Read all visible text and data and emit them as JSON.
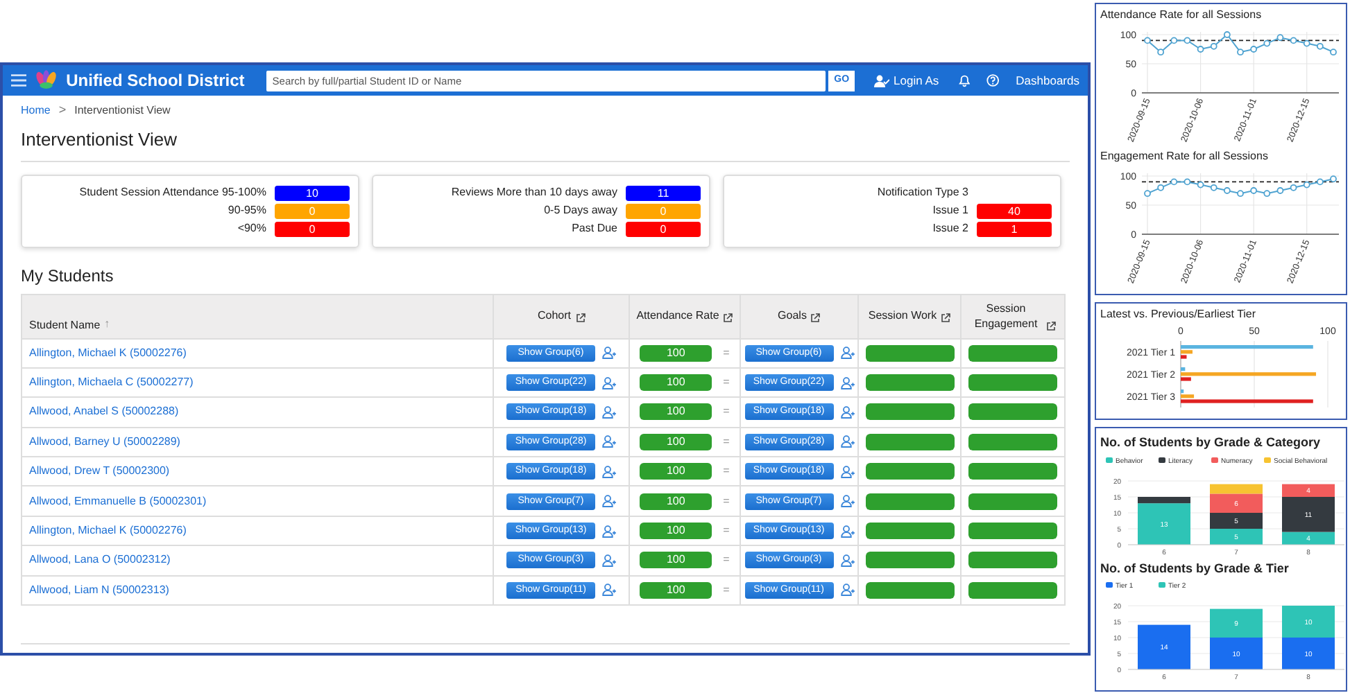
{
  "header": {
    "app_name": "Unified School District",
    "search": {
      "placeholder": "Search by full/partial Student ID or Name"
    },
    "go": "GO",
    "login_as": "Login As",
    "dashboards": "Dashboards"
  },
  "breadcrumb": {
    "separator": ">",
    "items": [
      {
        "label": "Home"
      },
      {
        "label": "Interventionist View"
      }
    ]
  },
  "title": "Interventionist View",
  "summary_cards": [
    {
      "items": [
        {
          "label": "Student Session Attendance 95-100%",
          "value": "10",
          "color": "#0000ff"
        },
        {
          "label": "90-95%",
          "value": "0",
          "color": "#ffa500"
        },
        {
          "label": "<90%",
          "value": "0",
          "color": "#ff0000"
        }
      ]
    },
    {
      "items": [
        {
          "label": "Reviews More than 10 days away",
          "value": "11",
          "color": "#0000ff"
        },
        {
          "label": "0-5 Days away",
          "value": "0",
          "color": "#ffa500"
        },
        {
          "label": "Past Due",
          "value": "0",
          "color": "#ff0000"
        }
      ]
    },
    {
      "items": [
        {
          "label": "Notification Type 3"
        },
        {
          "label": "Issue 1",
          "value": "40",
          "color": "#ff0000"
        },
        {
          "label": "Issue 2",
          "value": "1",
          "color": "#ff0000"
        }
      ]
    }
  ],
  "section_title": "My Students",
  "table": {
    "columns": [
      {
        "label": "Student Name",
        "sort_indicator": "↑",
        "link_icon": false
      },
      {
        "label": "Cohort",
        "link_icon": true
      },
      {
        "label": "Attendance Rate",
        "link_icon": true
      },
      {
        "label": "Goals",
        "link_icon": true
      },
      {
        "label": "Session Work",
        "link_icon": true
      },
      {
        "label": "Session Engagement",
        "link_icon": true
      }
    ],
    "rows": [
      {
        "student": "Allington, Michael K (50002276)",
        "cohort": "Show Group(6)",
        "attendance": "100",
        "trend": "=",
        "goals": "Show Group(6)",
        "session_work": {
          "level": 1
        },
        "session_engagement": {
          "level": 1
        }
      },
      {
        "student": "Allington, Michaela C (50002277)",
        "cohort": "Show Group(22)",
        "attendance": "100",
        "trend": "=",
        "goals": "Show Group(22)",
        "session_work": {
          "level": 1
        },
        "session_engagement": {
          "level": 1
        }
      },
      {
        "student": "Allwood, Anabel S (50002288)",
        "cohort": "Show Group(18)",
        "attendance": "100",
        "trend": "=",
        "goals": "Show Group(18)",
        "session_work": {
          "level": 1
        },
        "session_engagement": {
          "level": 1
        }
      },
      {
        "student": "Allwood, Barney U (50002289)",
        "cohort": "Show Group(28)",
        "attendance": "100",
        "trend": "=",
        "goals": "Show Group(28)",
        "session_work": {
          "level": 1
        },
        "session_engagement": {
          "level": 1
        }
      },
      {
        "student": "Allwood, Drew T (50002300)",
        "cohort": "Show Group(18)",
        "attendance": "100",
        "trend": "=",
        "goals": "Show Group(18)",
        "session_work": {
          "level": 1
        },
        "session_engagement": {
          "level": 1
        }
      },
      {
        "student": "Allwood, Emmanuelle B (50002301)",
        "cohort": "Show Group(7)",
        "attendance": "100",
        "trend": "=",
        "goals": "Show Group(7)",
        "session_work": {
          "level": 1
        },
        "session_engagement": {
          "level": 1
        }
      },
      {
        "student": "Allington, Michael K (50002276)",
        "cohort": "Show Group(13)",
        "attendance": "100",
        "trend": "=",
        "goals": "Show Group(13)",
        "session_work": {
          "level": 1
        },
        "session_engagement": {
          "level": 1
        }
      },
      {
        "student": "Allwood, Lana O (50002312)",
        "cohort": "Show Group(3)",
        "attendance": "100",
        "trend": "=",
        "goals": "Show Group(3)",
        "session_work": {
          "level": 1
        },
        "session_engagement": {
          "level": 1
        }
      },
      {
        "student": "Allwood, Liam N (50002313)",
        "cohort": "Show Group(11)",
        "attendance": "100",
        "trend": "=",
        "goals": "Show Group(11)",
        "session_work": {
          "level": 1
        },
        "session_engagement": {
          "level": 1
        }
      }
    ]
  },
  "side_panels": [
    {
      "charts": [
        {
          "chart_data": {
            "type": "line",
            "title": "Attendance Rate for all Sessions",
            "categories": [
              "2020-09-15",
              null,
              null,
              null,
              "2020-10-06",
              null,
              null,
              null,
              "2020-11-01",
              null,
              null,
              null,
              "2020-12-15",
              null,
              null
            ],
            "series": [
              {
                "color": "#4fa3d1",
                "marker": "circle",
                "values": [
                  90,
                  70,
                  90,
                  90,
                  75,
                  80,
                  100,
                  70,
                  75,
                  85,
                  95,
                  90,
                  85,
                  80,
                  70
                ]
              }
            ],
            "ylim": [
              0,
              100
            ],
            "yticks": [
              0,
              50,
              100
            ],
            "grid": true,
            "ref_lines": [
              {
                "axis": "y",
                "value": 90
              }
            ]
          }
        },
        {
          "chart_data": {
            "type": "line",
            "title": "Engagement Rate for all Sessions",
            "categories": [
              "2020-09-15",
              null,
              null,
              null,
              "2020-10-06",
              null,
              null,
              null,
              "2020-11-01",
              null,
              null,
              null,
              "2020-12-15",
              null,
              null
            ],
            "series": [
              {
                "color": "#4fa3d1",
                "marker": "circle",
                "values": [
                  70,
                  80,
                  90,
                  90,
                  85,
                  80,
                  75,
                  70,
                  75,
                  70,
                  75,
                  80,
                  85,
                  90,
                  95
                ]
              }
            ],
            "ylim": [
              0,
              100
            ],
            "yticks": [
              0,
              50,
              100
            ],
            "grid": true,
            "ref_lines": [
              {
                "axis": "y",
                "value": 90
              }
            ]
          }
        }
      ]
    },
    {
      "charts": [
        {
          "chart_data": {
            "type": "bar",
            "orientation": "horizontal",
            "title": "Latest vs. Previous/Earliest Tier",
            "categories": [
              "2021 Tier 1",
              "2021 Tier 2",
              "2021 Tier 3"
            ],
            "series": [
              {
                "color": "#5ab4e0",
                "values": [
                  90,
                  3,
                  2
                ]
              },
              {
                "color": "#f5a623",
                "values": [
                  8,
                  92,
                  9
                ]
              },
              {
                "color": "#e02020",
                "values": [
                  4,
                  7,
                  90
                ]
              }
            ],
            "xlim": [
              0,
              100
            ],
            "xticks": [
              0,
              50,
              100
            ]
          }
        }
      ]
    },
    {
      "charts": [
        {
          "chart_data": {
            "type": "bar",
            "stacked": true,
            "title": "No. of Students by Grade & Category",
            "categories": [
              "6",
              "7",
              "8"
            ],
            "series": [
              {
                "name": "Behavior",
                "color": "#2ec4b6",
                "values": [
                  13,
                  5,
                  4
                ]
              },
              {
                "name": "Literacy",
                "color": "#343a40",
                "values": [
                  2,
                  5,
                  11
                ]
              },
              {
                "name": "Numeracy",
                "color": "#f25c5c",
                "values": [
                  null,
                  6,
                  4
                ]
              },
              {
                "name": "Social Behavioral",
                "color": "#f7c331",
                "values": [
                  null,
                  3,
                  null
                ]
              }
            ],
            "ylim": [
              0,
              20
            ],
            "yticks": [
              0,
              5,
              10,
              15,
              20
            ],
            "grid": true,
            "legend": true,
            "value_labels": [
              [
                "13",
                "5",
                "4"
              ],
              [
                null,
                "5",
                "11"
              ],
              [
                null,
                "6",
                "4"
              ],
              [
                null,
                null,
                null
              ]
            ]
          }
        },
        {
          "chart_data": {
            "type": "bar",
            "stacked": true,
            "title": "No. of Students by Grade & Tier",
            "categories": [
              "6",
              "7",
              "8"
            ],
            "series": [
              {
                "name": "Tier 1",
                "color": "#1a6ef0",
                "values": [
                  14,
                  10,
                  10
                ]
              },
              {
                "name": "Tier 2",
                "color": "#2ec4b6",
                "values": [
                  null,
                  9,
                  10
                ]
              }
            ],
            "ylim": [
              0,
              20
            ],
            "yticks": [
              0,
              5,
              10,
              15,
              20
            ],
            "grid": true,
            "legend": true,
            "value_labels": [
              [
                "14",
                "10",
                "10"
              ],
              [
                null,
                "9",
                "10"
              ]
            ]
          }
        }
      ]
    }
  ]
}
